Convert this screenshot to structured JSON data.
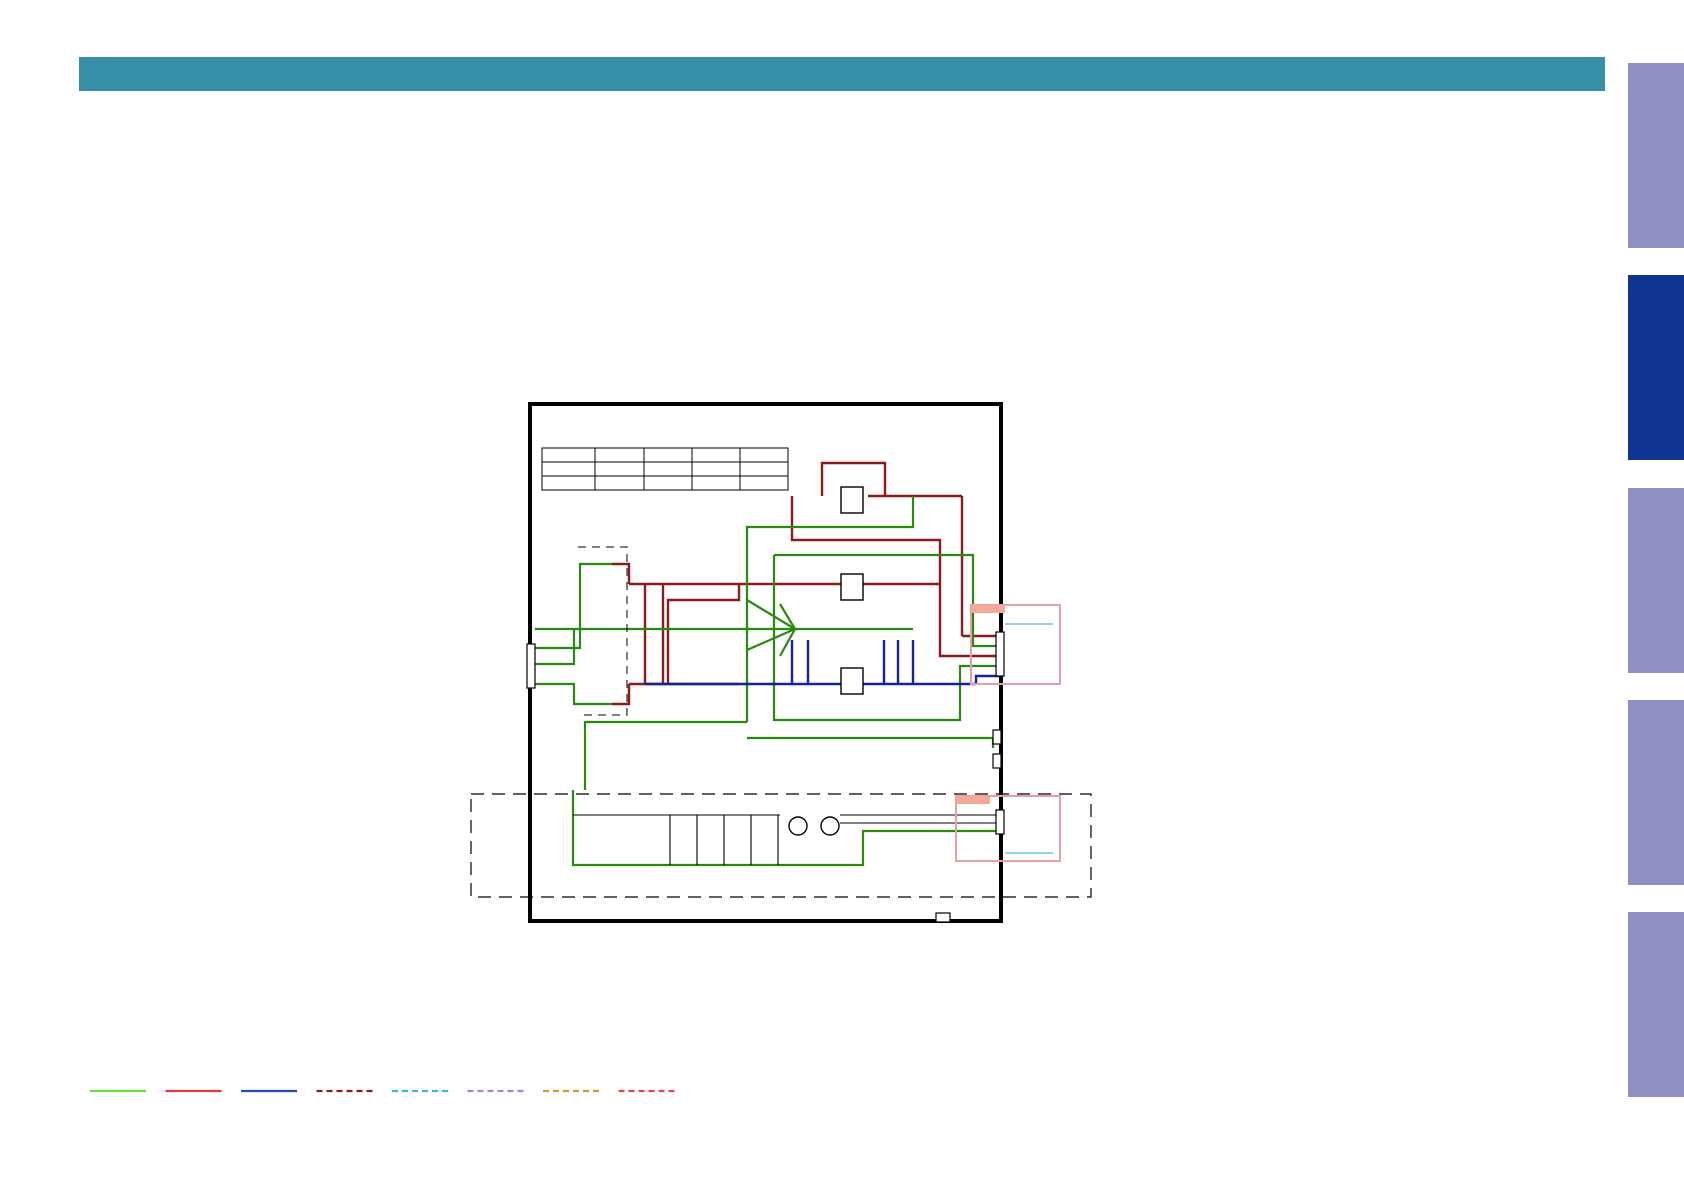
{
  "colors": {
    "header": "#3790a8",
    "tab_inactive": "#8f8fc4",
    "tab_active": "#0f3491",
    "wire_green": "#2a8a10",
    "wire_red": "#8a1c1c",
    "wire_blue": "#13239a",
    "frame": "#000000",
    "highlight_box": "#e8a0a8",
    "highlight_tag": "#f2aa96",
    "highlight_link": "#2aa7e0"
  },
  "side_tabs": [
    {
      "id": "tab-1",
      "active": false
    },
    {
      "id": "tab-2",
      "active": true
    },
    {
      "id": "tab-3",
      "active": false
    },
    {
      "id": "tab-4",
      "active": false
    },
    {
      "id": "tab-5",
      "active": false
    }
  ],
  "legend": {
    "line_styles": [
      {
        "name": "legend-line-1",
        "color": "#66dd44",
        "dashed": false
      },
      {
        "name": "legend-line-2",
        "color": "#e03a3a",
        "dashed": false
      },
      {
        "name": "legend-line-3",
        "color": "#2a4bb0",
        "dashed": false
      },
      {
        "name": "legend-line-4",
        "color": "#8a1c1c",
        "dashed": true
      },
      {
        "name": "legend-line-5",
        "color": "#38b8e0",
        "dashed": true
      },
      {
        "name": "legend-line-6",
        "color": "#8e8ef0",
        "dashed": true
      },
      {
        "name": "legend-line-7",
        "color": "#d89a30",
        "dashed": true
      },
      {
        "name": "legend-line-8",
        "color": "#e04848",
        "dashed": true
      }
    ]
  }
}
